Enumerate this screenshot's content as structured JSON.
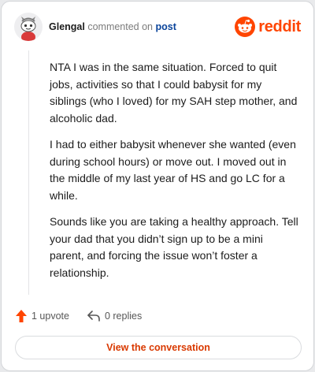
{
  "header": {
    "username": "Glengal",
    "action_text": "commented on",
    "target_link": "post",
    "logo_text": "reddit",
    "avatar_icon": "snoo-avatar-icon",
    "logo_icon": "reddit-snoo-icon"
  },
  "comment": {
    "paragraphs": [
      "NTA I was in the same situation. Forced to quit jobs, activities so that I could babysit for my siblings (who I loved) for my SAH step mother, and alcoholic dad.",
      "I had to either babysit whenever she wanted (even during school hours) or move out. I moved out in the middle of my last year of HS and go LC for a while.",
      "Sounds like you are taking a healthy approach. Tell your dad that you didn’t sign up to be a mini parent, and forcing the issue won’t foster a relationship."
    ]
  },
  "actions": {
    "upvotes": "1 upvote",
    "replies": "0 replies",
    "upvote_icon": "upvote-arrow-icon",
    "reply_icon": "reply-arrow-icon"
  },
  "footer": {
    "view_button": "View the conversation"
  },
  "colors": {
    "brand": "#ff4500",
    "link": "#0a449b",
    "button_text": "#d93900"
  }
}
